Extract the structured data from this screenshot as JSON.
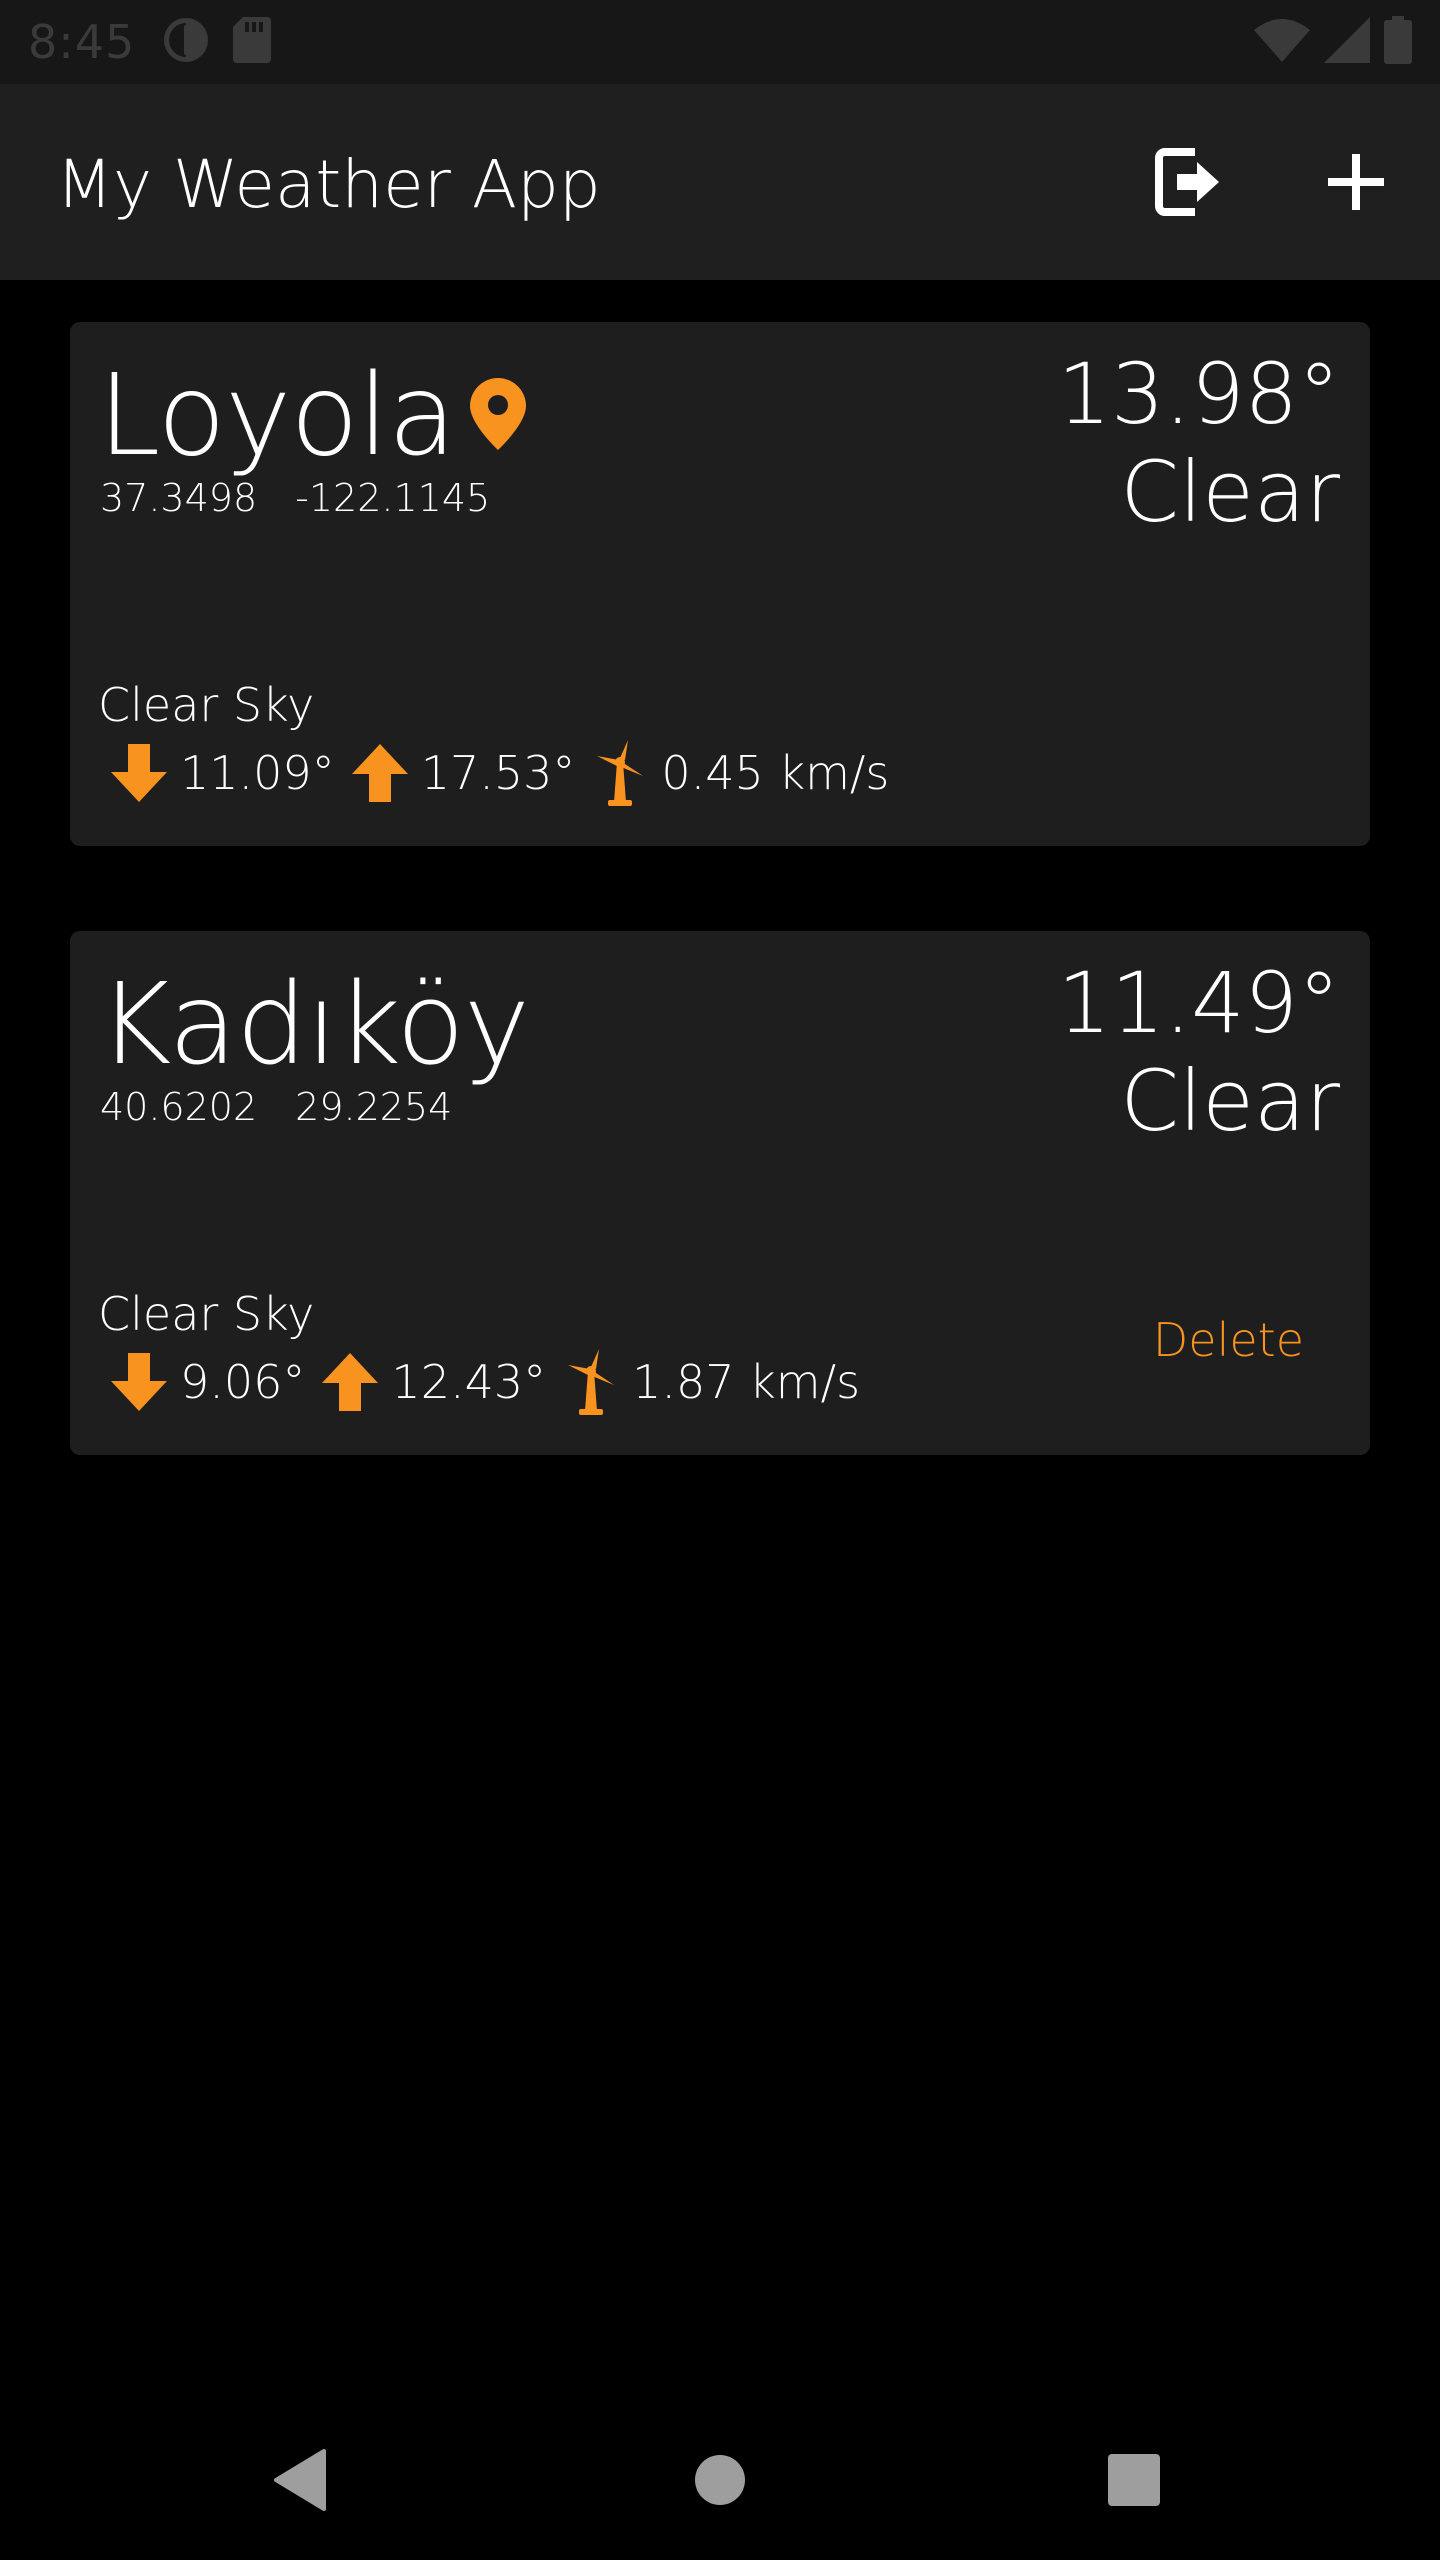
{
  "status_bar": {
    "time": "8:45",
    "icons": [
      "app-notification-icon",
      "sd-card-icon",
      "wifi-icon",
      "signal-icon",
      "battery-icon"
    ]
  },
  "app_bar": {
    "title": "My Weather App",
    "actions": [
      "logout-icon",
      "add-icon"
    ]
  },
  "colors": {
    "accent": "#f7931e",
    "card_bg": "#1e1e1e",
    "app_bar_bg": "#1f1f1f",
    "background": "#000000"
  },
  "cities": [
    {
      "name": "Loyola",
      "is_current_location": true,
      "lat": "37.3498",
      "lon": "-122.1145",
      "temp": "13.98°",
      "condition": "Clear",
      "description": "Clear Sky",
      "min_temp": "11.09°",
      "max_temp": "17.53°",
      "wind": "0.45 km/s"
    },
    {
      "name": "Kadıköy",
      "is_current_location": false,
      "lat": "40.6202",
      "lon": "29.2254",
      "temp": "11.49°",
      "condition": "Clear",
      "description": "Clear Sky",
      "min_temp": "9.06°",
      "max_temp": "12.43°",
      "wind": "1.87 km/s",
      "delete_label": "Delete"
    }
  ],
  "nav_bar": {
    "buttons": [
      "back-icon",
      "home-icon",
      "recents-icon"
    ]
  }
}
